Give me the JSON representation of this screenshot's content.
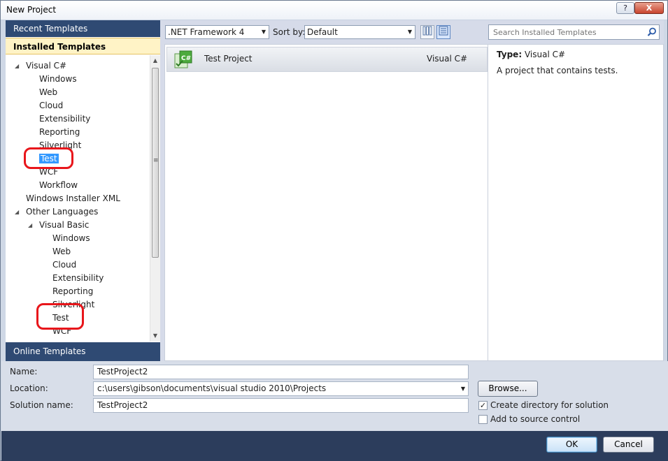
{
  "window": {
    "title": "New Project",
    "help": "?",
    "close": "X"
  },
  "left": {
    "recent": "Recent Templates",
    "installed": "Installed Templates",
    "online": "Online Templates",
    "tree": [
      {
        "label": "Visual C#",
        "level": 1,
        "arrow": true
      },
      {
        "label": "Windows",
        "level": 2
      },
      {
        "label": "Web",
        "level": 2
      },
      {
        "label": "Cloud",
        "level": 2
      },
      {
        "label": "Extensibility",
        "level": 2
      },
      {
        "label": "Reporting",
        "level": 2
      },
      {
        "label": "Silverlight",
        "level": 2
      },
      {
        "label": "Test",
        "level": 2,
        "selected": true
      },
      {
        "label": "WCF",
        "level": 2
      },
      {
        "label": "Workflow",
        "level": 2
      },
      {
        "label": "Windows Installer XML",
        "level": 1
      },
      {
        "label": "Other Languages",
        "level": 1,
        "arrow": true
      },
      {
        "label": "Visual Basic",
        "level": 2,
        "arrow": true
      },
      {
        "label": "Windows",
        "level": 3
      },
      {
        "label": "Web",
        "level": 3
      },
      {
        "label": "Cloud",
        "level": 3
      },
      {
        "label": "Extensibility",
        "level": 3
      },
      {
        "label": "Reporting",
        "level": 3
      },
      {
        "label": "Silverlight",
        "level": 3
      },
      {
        "label": "Test",
        "level": 3
      },
      {
        "label": "WCF",
        "level": 3
      }
    ]
  },
  "toolbar": {
    "framework": ".NET Framework 4",
    "sort_label": "Sort by:",
    "sort_value": "Default"
  },
  "search": {
    "placeholder": "Search Installed Templates"
  },
  "templates": [
    {
      "name": "Test Project",
      "language": "Visual C#"
    }
  ],
  "info": {
    "type_label": "Type:",
    "type_value": "Visual C#",
    "description": "A project that contains tests."
  },
  "form": {
    "name_label": "Name:",
    "name_value": "TestProject2",
    "location_label": "Location:",
    "location_value": "c:\\users\\gibson\\documents\\visual studio 2010\\Projects",
    "solution_label": "Solution name:",
    "solution_value": "TestProject2",
    "browse": "Browse...",
    "create_dir": "Create directory for solution",
    "create_dir_checked": true,
    "source_control": "Add to source control",
    "source_control_checked": false
  },
  "footer": {
    "ok": "OK",
    "cancel": "Cancel"
  },
  "colors": {
    "selection": "#3399ff",
    "header": "#2f4a73",
    "annotation": "#e8161b"
  }
}
